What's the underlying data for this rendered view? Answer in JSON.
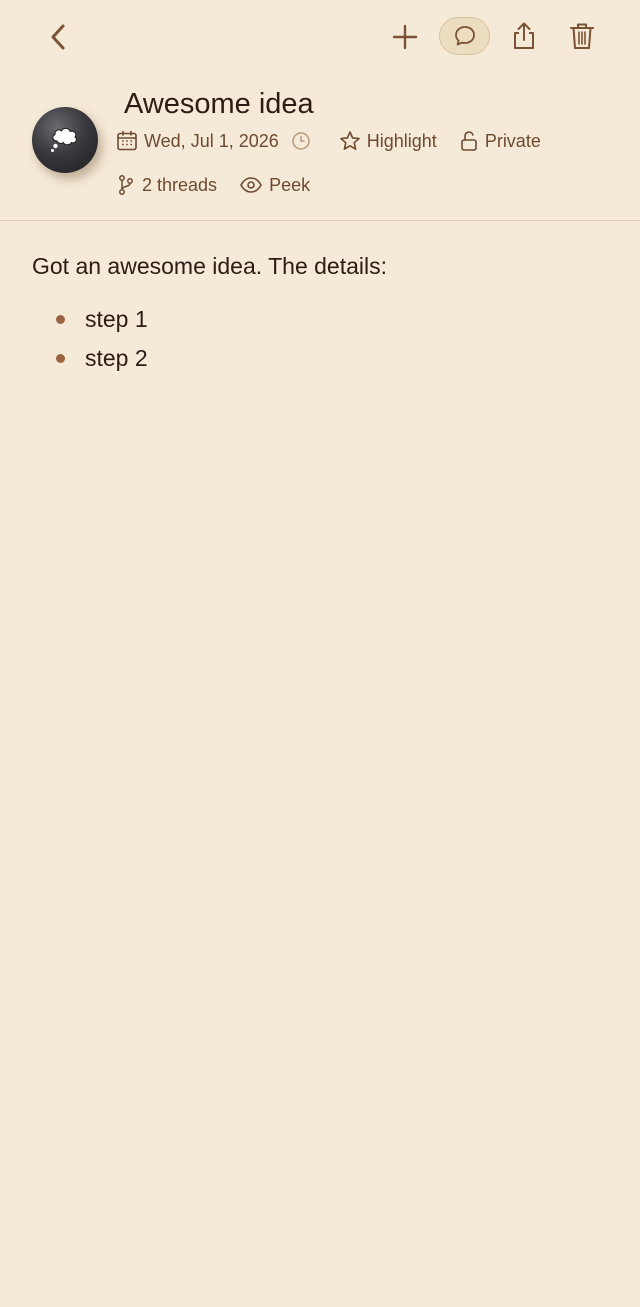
{
  "toolbar": {
    "back_icon": "chevron-left-icon",
    "add_icon": "plus-icon",
    "chat_icon": "speech-bubble-icon",
    "share_icon": "share-icon",
    "delete_icon": "trash-icon"
  },
  "note": {
    "avatar_icon": "thought-bubble-icon",
    "title": "Awesome idea",
    "date": "Wed, Jul 1, 2026",
    "highlight_label": "Highlight",
    "privacy_label": "Private",
    "threads_label": "2 threads",
    "peek_label": "Peek",
    "body_intro": "Got an awesome idea. The details:",
    "steps": [
      "step 1",
      "step 2"
    ]
  },
  "colors": {
    "background": "#f5e9d7",
    "icon": "#7a5234",
    "text": "#2b1d14",
    "meta_text": "#6e4a30",
    "bullet": "#9a6440"
  }
}
